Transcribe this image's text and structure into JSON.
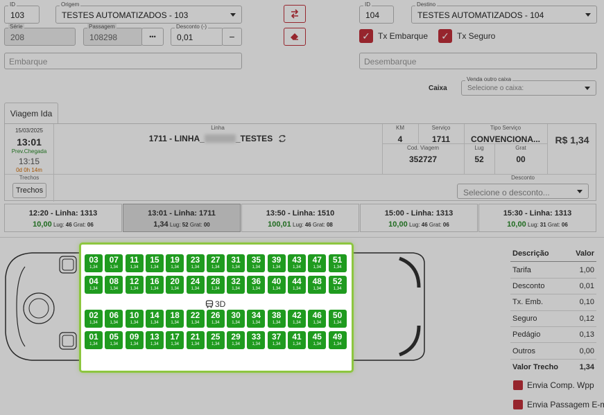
{
  "origin": {
    "id_legend": "ID",
    "id_value": "103",
    "city_legend": "Origem",
    "city_value": "TESTES AUTOMATIZADOS - 103",
    "serie_legend": "Série",
    "serie_value": "208",
    "passagem_legend": "Passagem",
    "passagem_value": "108298",
    "dots_label": "•••",
    "desconto_legend": "Desconto (-)",
    "desconto_value": "0,01",
    "minus_label": "−",
    "embarque_placeholder": "Embarque"
  },
  "destination": {
    "id_legend": "ID",
    "id_value": "104",
    "city_legend": "Destino",
    "city_value": "TESTES AUTOMATIZADOS - 104",
    "tx_embarque_label": "Tx Embarque",
    "tx_embarque_checked": true,
    "tx_seguro_label": "Tx Seguro",
    "tx_seguro_checked": true,
    "desembarque_placeholder": "Desembarque"
  },
  "caixa": {
    "label": "Caixa",
    "select_legend": "Venda outro caixa",
    "select_placeholder": "Selecione o caixa:"
  },
  "tab_label": "Viagem Ida",
  "trip": {
    "date": "15/03/2025",
    "time": "13:01",
    "prev_label": "Prev.Chegada",
    "arrival_time": "13:15",
    "duration": "0d 0h 14m",
    "linha_legend": "Linha",
    "linha_value": "1711 - LINHA_",
    "linha_suffix": "_TESTES",
    "km_legend": "KM",
    "km_value": "4",
    "servico_legend": "Serviço",
    "servico_value": "1711",
    "tipo_legend": "Tipo Serviço",
    "tipo_value": "CONVENCIONA...",
    "price": "R$ 1,34",
    "cod_legend": "Cod. Viagem",
    "cod_value": "352727",
    "lug_legend": "Lug",
    "lug_value": "52",
    "grat_legend": "Grat",
    "grat_value": "00",
    "trechos_legend": "Trechos",
    "trechos_button": "Trechos",
    "desconto_legend": "Desconto",
    "desconto_placeholder": "Selecione o desconto..."
  },
  "schedules": [
    {
      "title": "12:20 - Linha: 1313",
      "price": "10,00",
      "lug_label": "Lug:",
      "lug": "46",
      "grat_label": "Grat:",
      "grat": "06",
      "active": false
    },
    {
      "title": "13:01 - Linha: 1711",
      "price": "1,34",
      "lug_label": "Lug:",
      "lug": "52",
      "grat_label": "Grat:",
      "grat": "00",
      "active": true
    },
    {
      "title": "13:50 - Linha: 1510",
      "price": "100,01",
      "lug_label": "Lug:",
      "lug": "46",
      "grat_label": "Grat:",
      "grat": "08",
      "active": false
    },
    {
      "title": "15:00 - Linha: 1313",
      "price": "10,00",
      "lug_label": "Lug:",
      "lug": "46",
      "grat_label": "Grat:",
      "grat": "06",
      "active": false
    },
    {
      "title": "15:30 - Linha: 1313",
      "price": "10,00",
      "lug_label": "Lug:",
      "lug": "31",
      "grat_label": "Grat:",
      "grat": "06",
      "active": false
    }
  ],
  "seat_price": "1,34",
  "label_3d": "3D",
  "seat_rows": [
    [
      "03",
      "07",
      "11",
      "15",
      "19",
      "23",
      "27",
      "31",
      "35",
      "39",
      "43",
      "47",
      "51"
    ],
    [
      "04",
      "08",
      "12",
      "16",
      "20",
      "24",
      "28",
      "32",
      "36",
      "40",
      "44",
      "48",
      "52"
    ],
    [
      "02",
      "06",
      "10",
      "14",
      "18",
      "22",
      "26",
      "30",
      "34",
      "38",
      "42",
      "46",
      "50"
    ],
    [
      "01",
      "05",
      "09",
      "13",
      "17",
      "21",
      "25",
      "29",
      "33",
      "37",
      "41",
      "45",
      "49"
    ]
  ],
  "price_table": {
    "head": {
      "label": "Descrição",
      "value": "Valor"
    },
    "rows": [
      {
        "label": "Tarifa",
        "value": "1,00"
      },
      {
        "label": "Desconto",
        "value": "0,01"
      },
      {
        "label": "Tx. Emb.",
        "value": "0,10"
      },
      {
        "label": "Seguro",
        "value": "0,12"
      },
      {
        "label": "Pedágio",
        "value": "0,13"
      },
      {
        "label": "Outros",
        "value": "0,00"
      }
    ],
    "total": {
      "label": "Valor Trecho",
      "value": "1,34"
    }
  },
  "send_options": [
    "Envia Comp. Wpp",
    "Envia Passagem E-mail"
  ],
  "colors": {
    "seat": "#1f9b1f",
    "highlight": "#8dc63f",
    "accent": "#c0303a",
    "price_green": "#2a8a2a"
  }
}
